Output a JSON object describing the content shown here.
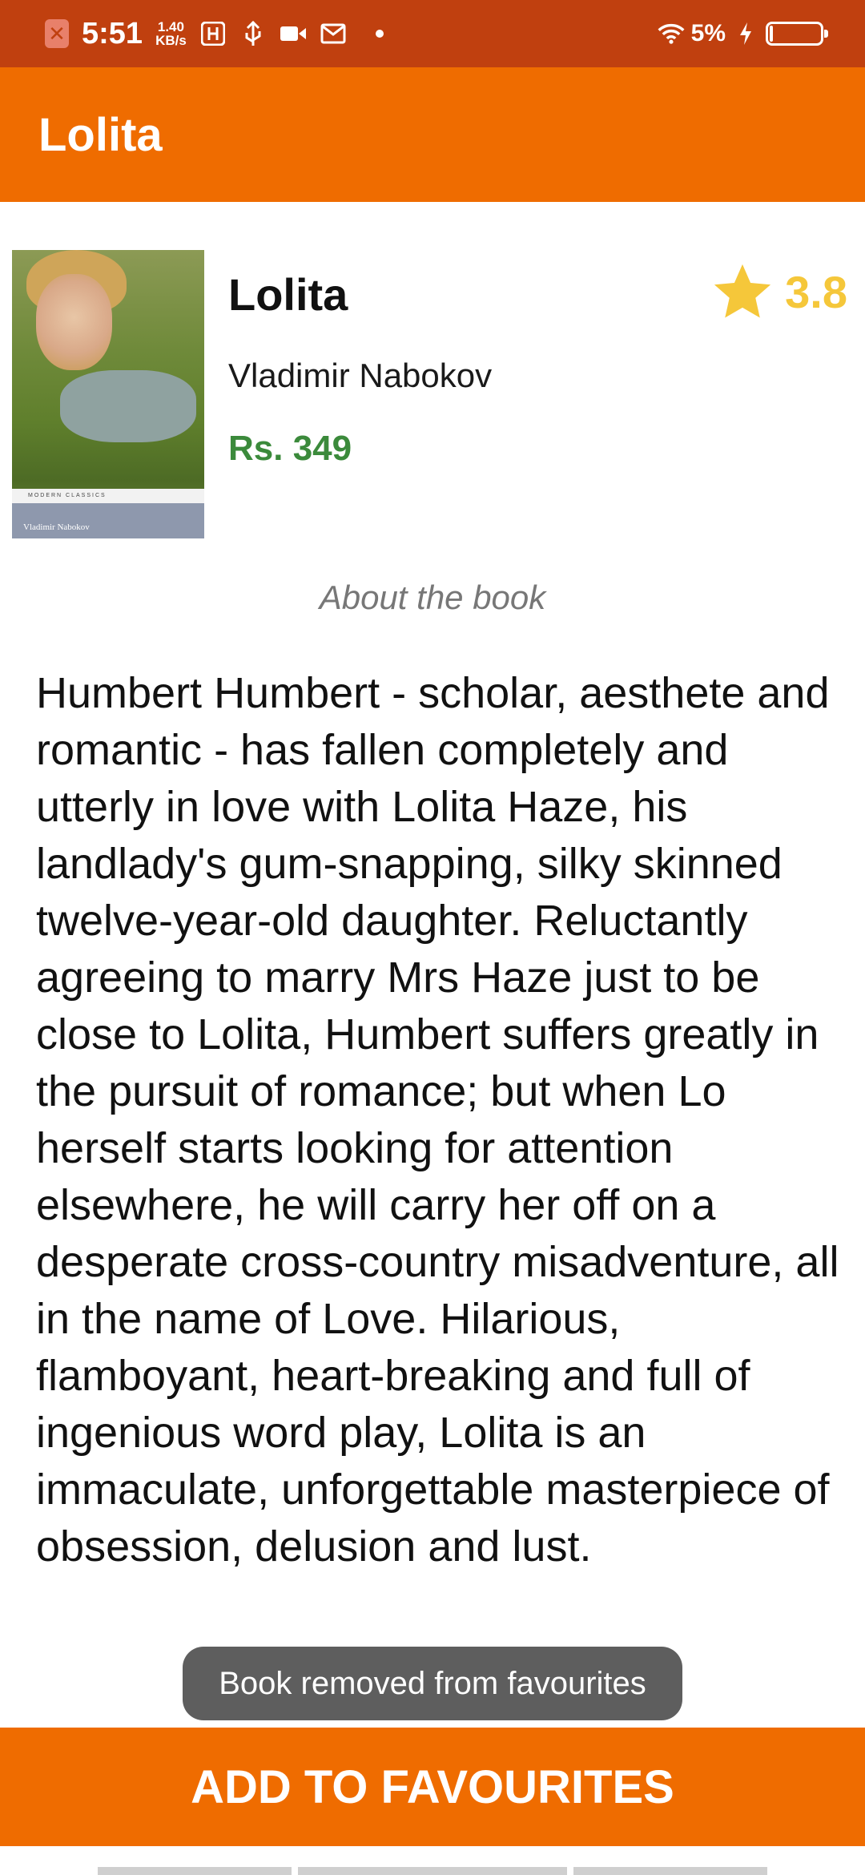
{
  "status_bar": {
    "time": "5:51",
    "speed_value": "1.40",
    "speed_unit": "KB/s",
    "battery_percent": "5%",
    "icons": [
      "close-icon",
      "usb-debug-icon",
      "usb-icon",
      "video-icon",
      "gmail-icon",
      "dot-icon",
      "wifi-icon",
      "charging-icon",
      "battery-icon"
    ]
  },
  "app_bar": {
    "title": "Lolita"
  },
  "book": {
    "title": "Lolita",
    "author": "Vladimir Nabokov",
    "price": "Rs. 349",
    "rating": "3.8",
    "cover": {
      "series_text": "MODERN CLASSICS",
      "author_text": "Vladimir Nabokov"
    }
  },
  "about": {
    "heading": "About the book",
    "text": "Humbert Humbert - scholar, aesthete and romantic - has fallen completely and utterly in love with Lolita Haze, his landlady's gum-snapping, silky skinned twelve-year-old daughter. Reluctantly agreeing to marry Mrs Haze just to be close to Lolita, Humbert suffers greatly in the pursuit of romance; but when Lo herself starts looking for attention elsewhere, he will carry her off on a desperate cross-country misadventure, all in the name of Love. Hilarious, flamboyant, heart-breaking and full of ingenious word play, Lolita is an immaculate, unforgettable masterpiece of obsession, delusion and lust."
  },
  "toast": {
    "message": "Book removed from favourites"
  },
  "actions": {
    "add_to_favourites": "ADD TO FAVOURITES"
  },
  "colors": {
    "primary": "#ef6c00",
    "status_bar": "#c0400f",
    "price": "#3b8a3b",
    "rating": "#f5c73a"
  }
}
